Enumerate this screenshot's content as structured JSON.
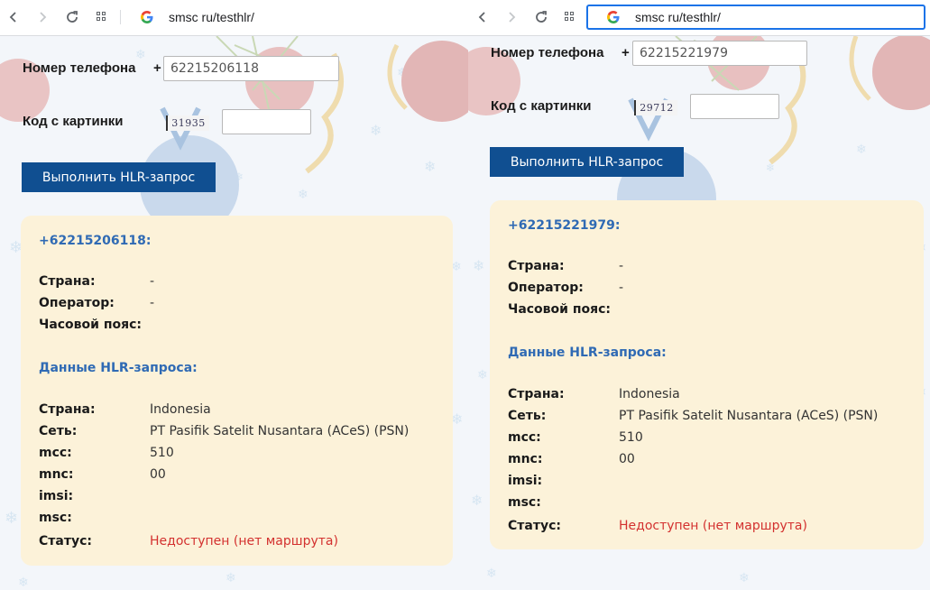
{
  "left": {
    "url": "smsc ru/testhlr/",
    "form": {
      "phone_label": "Номер телефона",
      "plus": "+",
      "phone_value": "62215206118",
      "captcha_label": "Код с картинки",
      "captcha_text": "31935",
      "captcha_value": "",
      "submit_label": "Выполнить HLR-запрос"
    },
    "result": {
      "phone": "+62215206118:",
      "basic": [
        {
          "k": "Страна:",
          "v": "-"
        },
        {
          "k": "Оператор:",
          "v": "-"
        },
        {
          "k": "Часовой пояс:",
          "v": ""
        }
      ],
      "hlr_title": "Данные HLR-запроса:",
      "hlr": [
        {
          "k": "Страна:",
          "v": "Indonesia"
        },
        {
          "k": "Сеть:",
          "v": "PT Pasifik Satelit Nusantara (ACeS) (PSN)"
        },
        {
          "k": "mcc:",
          "v": "510"
        },
        {
          "k": "mnc:",
          "v": "00"
        },
        {
          "k": "imsi:",
          "v": ""
        },
        {
          "k": "msc:",
          "v": ""
        },
        {
          "k": "Статус:",
          "v": "Недоступен (нет маршрута)"
        }
      ]
    }
  },
  "right": {
    "url": "smsc ru/testhlr/",
    "form": {
      "phone_label": "Номер телефона",
      "plus": "+",
      "phone_value": "62215221979",
      "captcha_label": "Код с картинки",
      "captcha_text": "29712",
      "captcha_value": "",
      "submit_label": "Выполнить HLR-запрос"
    },
    "result": {
      "phone": "+62215221979:",
      "basic": [
        {
          "k": "Страна:",
          "v": "-"
        },
        {
          "k": "Оператор:",
          "v": "-"
        },
        {
          "k": "Часовой пояс:",
          "v": ""
        }
      ],
      "hlr_title": "Данные HLR-запроса:",
      "hlr": [
        {
          "k": "Страна:",
          "v": "Indonesia"
        },
        {
          "k": "Сеть:",
          "v": "PT Pasifik Satelit Nusantara (ACeS) (PSN)"
        },
        {
          "k": "mcc:",
          "v": "510"
        },
        {
          "k": "mnc:",
          "v": "00"
        },
        {
          "k": "imsi:",
          "v": ""
        },
        {
          "k": "msc:",
          "v": ""
        },
        {
          "k": "Статус:",
          "v": "Недоступен (нет маршрута)"
        }
      ]
    }
  },
  "icons": {
    "back": "back-arrow-icon",
    "forward": "forward-arrow-icon",
    "reload": "reload-icon",
    "apps": "apps-grid-icon",
    "site": "google-g-icon"
  },
  "colors": {
    "button": "#104f91",
    "card": "#fcf2d9",
    "heading_blue": "#2f6ab4",
    "status_red": "#d3312f"
  }
}
